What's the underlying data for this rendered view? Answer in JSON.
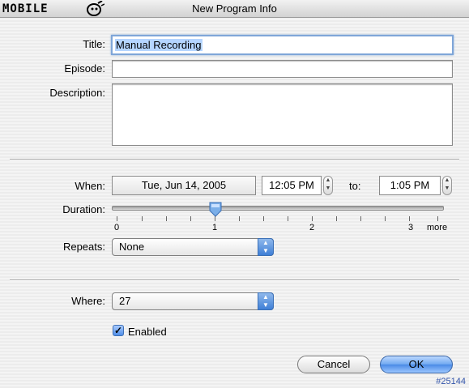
{
  "window": {
    "title": "New Program Info",
    "logo_text": "MOBILE",
    "logo_icon": "tivo-like-mascot-icon"
  },
  "form": {
    "title_label": "Title:",
    "title_value": "Manual Recording",
    "episode_label": "Episode:",
    "episode_value": "",
    "description_label": "Description:",
    "description_value": "",
    "when_label": "When:",
    "date_value": "Tue, Jun 14, 2005",
    "start_time": "12:05 PM",
    "to_label": "to:",
    "end_time": "1:05 PM",
    "duration_label": "Duration:",
    "duration_ticks": [
      "0",
      "1",
      "2",
      "3",
      "more"
    ],
    "duration_value_hours": 1,
    "repeats_label": "Repeats:",
    "repeats_value": "None",
    "where_label": "Where:",
    "where_value": "27",
    "enabled_label": "Enabled",
    "enabled_checked": true
  },
  "buttons": {
    "cancel": "Cancel",
    "ok": "OK"
  },
  "footer": {
    "id_tag": "#25144"
  }
}
